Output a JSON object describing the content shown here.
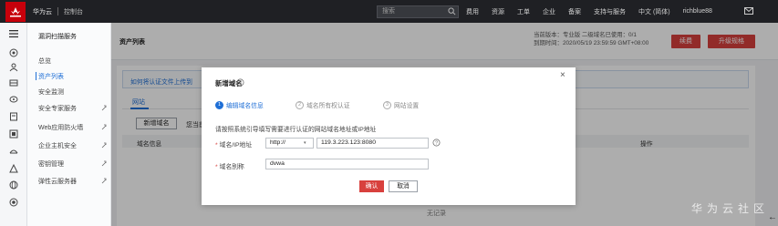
{
  "topbar": {
    "brand": "华为云",
    "console": "控制台",
    "search_placeholder": "搜索",
    "nav": [
      "费用",
      "资源",
      "工单",
      "企业",
      "备案",
      "支持与服务",
      "中文 (简体)",
      "richblue88"
    ],
    "colors": {
      "bg": "#1f2024",
      "accent": "#d8403d"
    }
  },
  "rail": {
    "icons": [
      "menu-icon",
      "cloud-icon",
      "user-group-icon",
      "server-icon",
      "monitor-icon",
      "database-icon",
      "storage-icon",
      "network-icon",
      "security-icon",
      "globe-icon",
      "settings-icon"
    ]
  },
  "sidebar": {
    "title": "漏洞扫描服务",
    "items": [
      {
        "label": "总览",
        "active": false
      },
      {
        "label": "资产列表",
        "active": true
      },
      {
        "label": "安全监测",
        "active": false
      },
      {
        "label": "安全专家服务",
        "active": false
      },
      {
        "label": "Web应用防火墙",
        "active": false
      },
      {
        "label": "企业主机安全",
        "active": false
      },
      {
        "label": "密钥管理",
        "active": false
      },
      {
        "label": "弹性云服务器",
        "active": false
      }
    ]
  },
  "main": {
    "page_title": "资产列表",
    "version_line1": "当前版本：专业版   二级域名已使用：0/1",
    "version_line2": "到期时间：2020/05/19 23:59:59 GMT+08:00",
    "renew_label": "续费",
    "upgrade_label": "升级规格",
    "tip_text": "如何将认证文件上传到",
    "tab_label": "网站",
    "add_button": "新增域名",
    "cert_text": "您当前",
    "col_domain": "域名信息",
    "col_action": "操作",
    "empty_text": "无记录"
  },
  "modal": {
    "title": "新增域名",
    "close": "×",
    "steps": [
      {
        "num": "1",
        "label": "编辑域名信息",
        "active": true
      },
      {
        "num": "2",
        "label": "域名所有权认证",
        "active": false
      },
      {
        "num": "3",
        "label": "网站设置",
        "active": false
      }
    ],
    "description": "请按照系统引导填写需要进行认证的网站域名地址或IP地址",
    "domain_label": "域名/IP地址",
    "protocol_value": "http://",
    "domain_value": "119.3.223.123:8080",
    "alias_label": "域名别称",
    "alias_value": "dvwa",
    "ok_label": "确认",
    "cancel_label": "取消"
  },
  "watermark": "华为云社区"
}
